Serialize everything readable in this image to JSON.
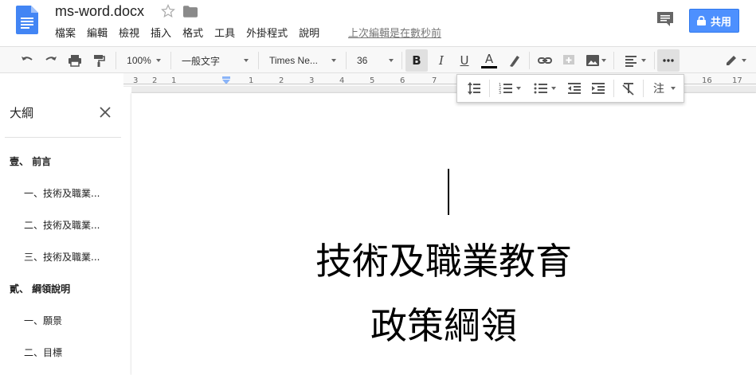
{
  "header": {
    "doc_title": "ms-word.docx",
    "menu": [
      "檔案",
      "編輯",
      "檢視",
      "插入",
      "格式",
      "工具",
      "外掛程式",
      "說明"
    ],
    "last_edit": "上次編輯是在數秒前",
    "share_label": "共用",
    "accent": "#4d90fe"
  },
  "toolbar": {
    "zoom": "100%",
    "style": "一般文字",
    "font": "Times Ne...",
    "font_size": "36",
    "bold_label": "B",
    "italic_label": "I",
    "underline_label": "U",
    "text_color_label": "A"
  },
  "ruler": {
    "ticks": [
      "3",
      "2",
      "1",
      "1",
      "2",
      "3",
      "4",
      "5",
      "6",
      "7",
      "16",
      "17"
    ]
  },
  "float_toolbar": {
    "annotation_label": "注"
  },
  "outline": {
    "title": "大綱",
    "items": [
      {
        "label": "壹、 前言",
        "level": 1
      },
      {
        "label": "一、技術及職業...",
        "level": 2
      },
      {
        "label": "二、技術及職業...",
        "level": 2
      },
      {
        "label": "三、技術及職業...",
        "level": 2
      },
      {
        "label": "貳、 綱領說明",
        "level": 1
      },
      {
        "label": "一、願景",
        "level": 2
      },
      {
        "label": "二、目標",
        "level": 2
      }
    ]
  },
  "document": {
    "lines": [
      "技術及職業教育",
      "政策綱領"
    ]
  }
}
